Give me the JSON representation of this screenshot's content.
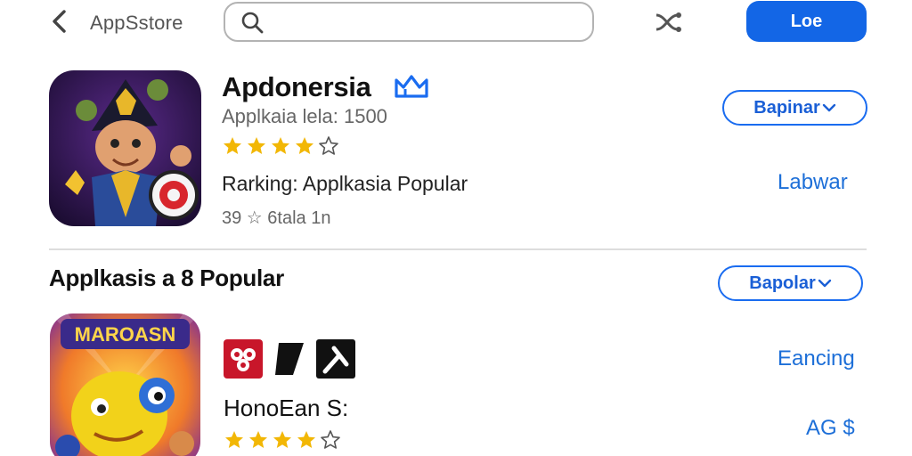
{
  "header": {
    "store_title": "AppSstore",
    "search_placeholder": "",
    "login_label": "Loe"
  },
  "featured_app": {
    "name": "Apdonersia",
    "subtitle": "Applkaia lela: 1500",
    "rating_stars": 4,
    "rating_max": 5,
    "ranking": "Rarking: Applkasia Popular",
    "reviews": "39 ☆ 6tala 1n",
    "action_label": "Bapinar",
    "link_label": "Labwar"
  },
  "section": {
    "title": "Applkasis a 8 Popular",
    "action_label": "Bapolar"
  },
  "second_app": {
    "icon_text": "MAROASN",
    "name": "HonoEan S:",
    "rating_stars": 4,
    "rating_max": 5,
    "link_label": "Eancing",
    "price": "AG $"
  },
  "colors": {
    "accent": "#1366e6",
    "star": "#f2b705",
    "link": "#1d6fd8"
  },
  "icons": {
    "back": "chevron-left-icon",
    "search": "search-icon",
    "share": "share-icon",
    "badge": "crown-icon",
    "dropdown": "chevron-down-icon"
  }
}
